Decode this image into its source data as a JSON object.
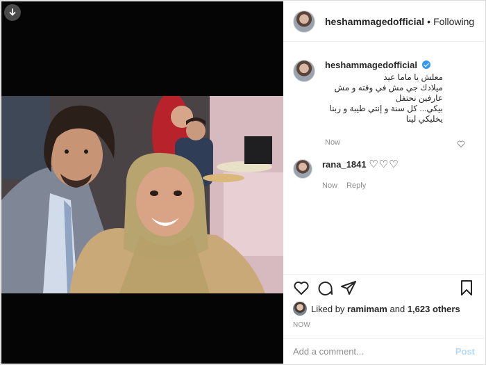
{
  "post": {
    "username": "heshammagedofficial",
    "follow_label": "Following",
    "separator": "•"
  },
  "caption": {
    "username": "heshammagedofficial",
    "lines": [
      "معلش يا ماما عيد",
      "ميلادك جي مش في وقته و مش عارفين نحتفل",
      "بيكي... كل سنة و إنتي طيبة و ربنا يخليكي لينا"
    ],
    "time": "Now"
  },
  "comment": {
    "username": "rana_1841",
    "text": "♡♡♡",
    "time": "Now",
    "reply_label": "Reply"
  },
  "likes": {
    "prefix": "Liked by",
    "user": "ramimam",
    "middle": "and",
    "count": "1,623 others"
  },
  "timestamp": "NOW",
  "add_comment": {
    "placeholder": "Add a comment...",
    "post_label": "Post"
  },
  "colors": {
    "verified": "#3897f0",
    "post_disabled": "#b3dbff",
    "meta": "#8e8e8e"
  },
  "icons": [
    "download-icon",
    "verified-icon",
    "heart-icon",
    "comment-icon",
    "share-icon",
    "bookmark-icon"
  ]
}
